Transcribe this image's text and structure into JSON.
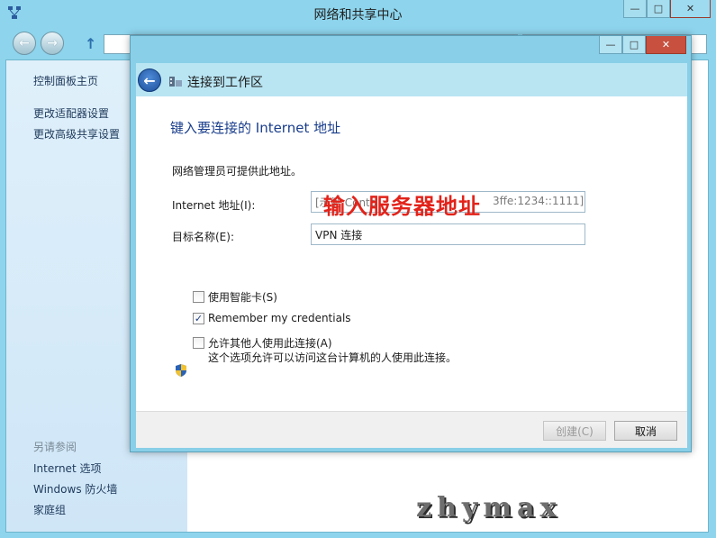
{
  "outer_window": {
    "title": "网络和共享中心",
    "caption": {
      "minimize": "—",
      "maximize": "□",
      "close": "✕"
    }
  },
  "left_pane": {
    "links": [
      "控制面板主页",
      "更改适配器设置",
      "更改高级共享设置"
    ],
    "see_also_heading": "另请参阅",
    "see_also_links": [
      "Internet 选项",
      "Windows 防火墙",
      "家庭组"
    ]
  },
  "dialog": {
    "title": "连接到工作区",
    "caption": {
      "minimize": "—",
      "maximize": "□",
      "close": "✕"
    },
    "heading": "键入要连接的 Internet 地址",
    "description": "网络管理员可提供此地址。",
    "internet_address_label": "Internet 地址(I):",
    "internet_address_value_left": "[示例:Conto",
    "internet_address_value_right": "3ffe:1234::1111]",
    "destination_name_label": "目标名称(E):",
    "destination_name_value": "VPN 连接",
    "annotation": "输入服务器地址",
    "options": [
      {
        "label": "使用智能卡(S)",
        "checked": false
      },
      {
        "label": "Remember my credentials",
        "checked": true
      },
      {
        "label": "允许其他人使用此连接(A)",
        "checked": false
      }
    ],
    "allow_note": "这个选项允许可以访问这台计算机的人使用此连接。",
    "create_button": "创建(C)",
    "cancel_button": "取消"
  },
  "watermark": "zhymax",
  "colors": {
    "accent": "#8dd4ec",
    "annotation_red": "#e2231a",
    "heading_blue": "#1a3e8c",
    "close_red": "#c94c3c"
  }
}
